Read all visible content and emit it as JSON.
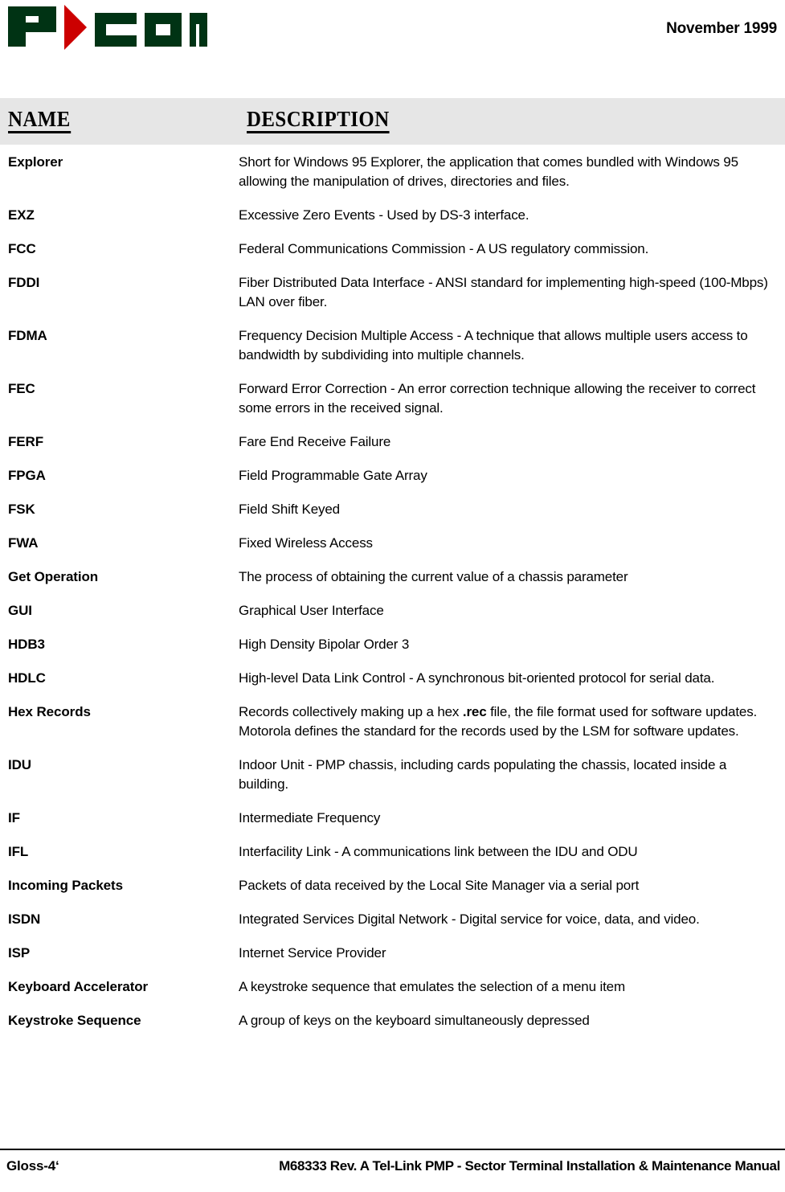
{
  "header": {
    "logo_text": "P COM",
    "logo_mark": "triangle-play-mark",
    "logo_green": "#003314",
    "logo_red": "#CC0000",
    "date": "November 1999"
  },
  "table": {
    "header_background": "#E6E6E6",
    "columns": {
      "name": "NAME",
      "description": "DESCRIPTION"
    },
    "rows": [
      {
        "term": "Explorer",
        "definition": "Short for Windows 95 Explorer, the application that comes bundled with Windows 95 allowing the manipulation of drives, directories and files."
      },
      {
        "term": "EXZ",
        "definition": "Excessive Zero Events - Used by DS-3 interface."
      },
      {
        "term": "FCC",
        "definition": "Federal Communications Commission - A US regulatory commission."
      },
      {
        "term": "FDDI",
        "definition": "Fiber Distributed Data Interface - ANSI standard for implementing high-speed (100-Mbps) LAN over fiber."
      },
      {
        "term": "FDMA",
        "definition": "Frequency Decision Multiple Access - A technique that allows multiple users access to bandwidth by subdividing into multiple channels."
      },
      {
        "term": "FEC",
        "definition": "Forward Error Correction - An error correction technique allowing the receiver to correct some errors in the received signal."
      },
      {
        "term": "FERF",
        "definition": "Fare End Receive Failure"
      },
      {
        "term": "FPGA",
        "definition": "Field Programmable Gate Array"
      },
      {
        "term": "FSK",
        "definition": "Field Shift Keyed"
      },
      {
        "term": "FWA",
        "definition": "Fixed Wireless Access"
      },
      {
        "term": "Get Operation",
        "definition": "The process of obtaining the current value of a chassis parameter"
      },
      {
        "term": "GUI",
        "definition": "Graphical User Interface"
      },
      {
        "term": "HDB3",
        "definition": "High Density Bipolar Order 3"
      },
      {
        "term": "HDLC",
        "definition": "High-level Data Link Control - A synchronous bit-oriented protocol for serial data."
      },
      {
        "term": "Hex Records",
        "definition_html": "Records collectively making up a hex <b>.rec</b> file, the file format used for software updates. Motorola defines the standard for the records used by the LSM for software updates."
      },
      {
        "term": "IDU",
        "definition": "Indoor Unit - PMP chassis, including cards populating the chassis, located inside a building."
      },
      {
        "term": "IF",
        "definition": "Intermediate Frequency"
      },
      {
        "term": "IFL",
        "definition": "Interfacility Link - A communications link between the IDU and ODU"
      },
      {
        "term": "Incoming Packets",
        "definition": "Packets of data received by the Local Site Manager via a serial port"
      },
      {
        "term": "ISDN",
        "definition": "Integrated Services Digital Network - Digital service for voice, data, and video."
      },
      {
        "term": "ISP",
        "definition": "Internet Service Provider"
      },
      {
        "term": "Keyboard Accelerator",
        "definition": "A keystroke sequence that emulates the selection of a menu item"
      },
      {
        "term": "Keystroke Sequence",
        "definition": "A group of keys on the keyboard simultaneously depressed"
      }
    ]
  },
  "footer": {
    "page_label": "Gloss-4‘",
    "document_title": "M68333 Rev. A Tel-Link PMP - Sector Terminal Installation & Maintenance Manual"
  }
}
